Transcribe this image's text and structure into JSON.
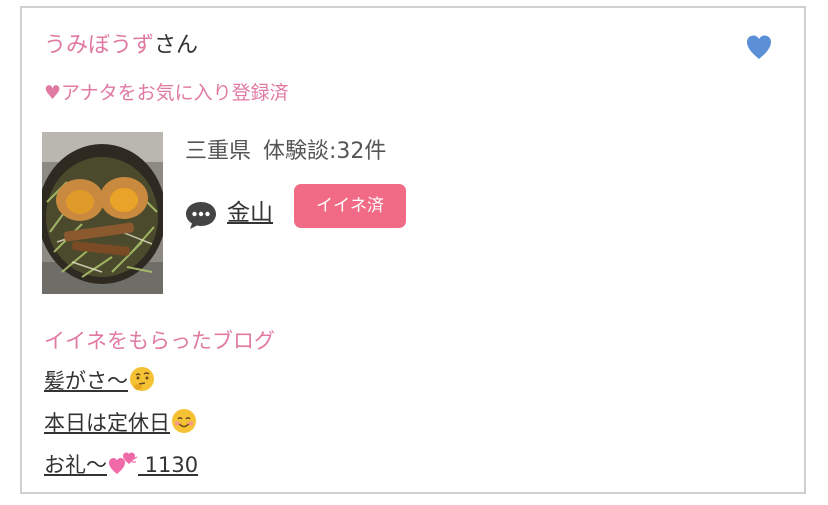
{
  "profile": {
    "username": "うみぼうず",
    "honorific": "さん",
    "favorite_status": "♥アナタをお気に入り登録済",
    "prefecture": "三重県",
    "experience_count": "体験談:32件",
    "heart_icon": "heart-icon",
    "heart_color": "#5b8fd6"
  },
  "shop": {
    "name": "金山",
    "like_badge": "イイネ済",
    "badge_color": "#f26b86",
    "comment_icon": "speech-bubble-icon"
  },
  "blogs": {
    "heading": "イイネをもらったブログ",
    "items": [
      {
        "title": "髪がさ〜",
        "emoji": "thinking-face-emoji"
      },
      {
        "title": "本日は定休日",
        "emoji": "smiling-face-emoji"
      },
      {
        "title": "お礼〜",
        "emoji": "two-hearts-emoji",
        "suffix": " 1130"
      }
    ]
  },
  "colors": {
    "accent_pink": "#e07aa3",
    "border": "#cfcfcf",
    "text": "#333333"
  }
}
